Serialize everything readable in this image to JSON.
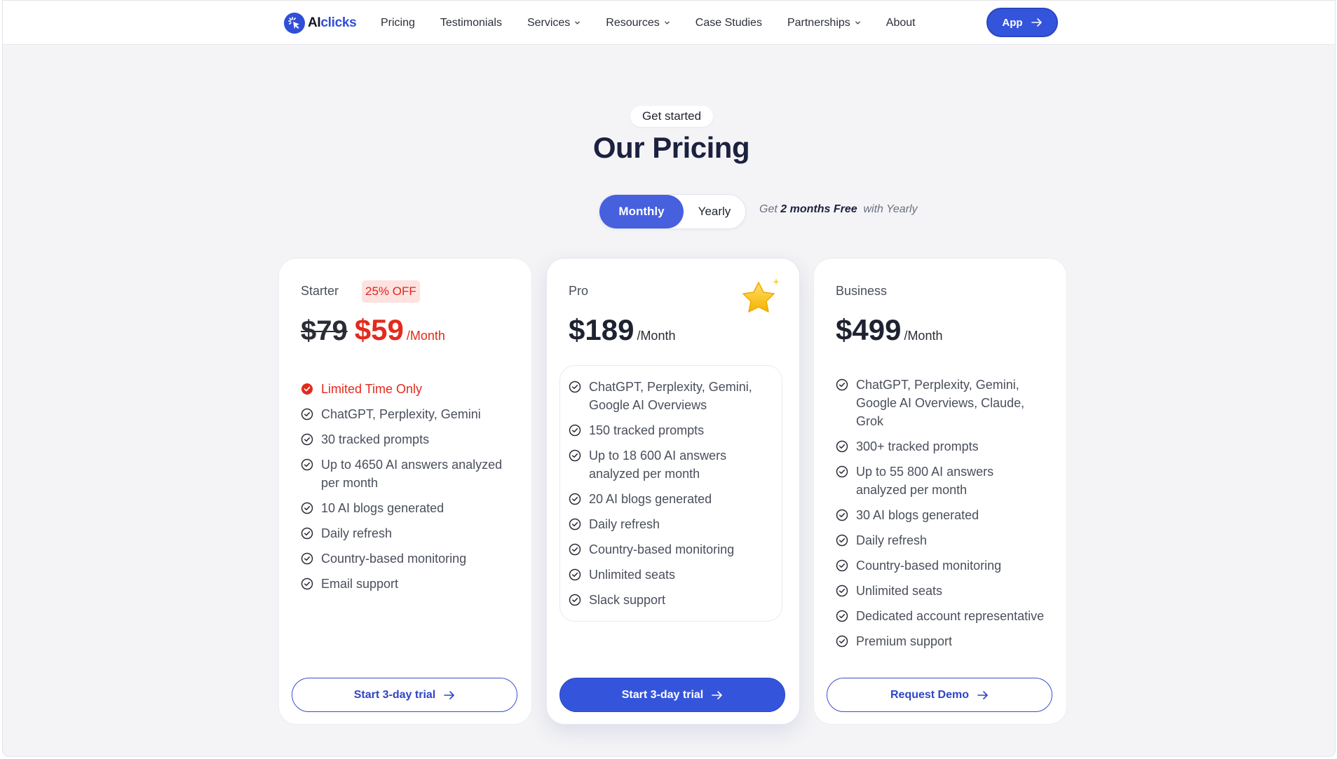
{
  "nav": {
    "logo_ai": "AI",
    "logo_clicks": "clicks",
    "links": [
      {
        "label": "Pricing",
        "dropdown": false
      },
      {
        "label": "Testimonials",
        "dropdown": false
      },
      {
        "label": "Services",
        "dropdown": true
      },
      {
        "label": "Resources",
        "dropdown": true
      },
      {
        "label": "Case Studies",
        "dropdown": false
      },
      {
        "label": "Partnerships",
        "dropdown": true
      },
      {
        "label": "About",
        "dropdown": false
      }
    ],
    "app_button": "App"
  },
  "hero": {
    "eyebrow": "Get started",
    "title": "Our Pricing"
  },
  "billing": {
    "monthly": "Monthly",
    "yearly": "Yearly",
    "selected": "Monthly",
    "promo_pre": "Get",
    "promo_bold": "2 months Free",
    "promo_post": "with Yearly"
  },
  "plans": [
    {
      "name": "Starter",
      "badge": "25% OFF",
      "old_price": "$79",
      "price": "$59",
      "per": "/Month",
      "highlight": "Limited Time Only",
      "features": [
        "ChatGPT, Perplexity, Gemini",
        "30 tracked prompts",
        "Up to 4650 AI answers analyzed per month",
        "10 AI blogs generated",
        "Daily refresh",
        "Country-based monitoring",
        "Email support"
      ],
      "cta": "Start 3-day trial"
    },
    {
      "name": "Pro",
      "price": "$189",
      "per": "/Month",
      "icon": "star-icon",
      "features": [
        "ChatGPT, Perplexity, Gemini, Google AI Overviews",
        "150 tracked prompts",
        "Up to 18 600 AI answers analyzed per month",
        "20 AI blogs generated",
        "Daily refresh",
        "Country-based monitoring",
        "Unlimited seats",
        "Slack support"
      ],
      "cta": "Start 3-day trial"
    },
    {
      "name": "Business",
      "price": "$499",
      "per": "/Month",
      "features": [
        "ChatGPT, Perplexity, Gemini, Google AI Overviews, Claude, Grok",
        "300+ tracked prompts",
        "Up to 55 800 AI answers analyzed per month",
        "30 AI blogs generated",
        "Daily refresh",
        "Country-based monitoring",
        "Unlimited seats",
        "Dedicated account representative",
        "Premium support"
      ],
      "cta": "Request Demo"
    }
  ],
  "colors": {
    "brand": "#3455db",
    "accent_red": "#e32a1c",
    "title": "#1c2140",
    "background": "#f4f4f6"
  }
}
